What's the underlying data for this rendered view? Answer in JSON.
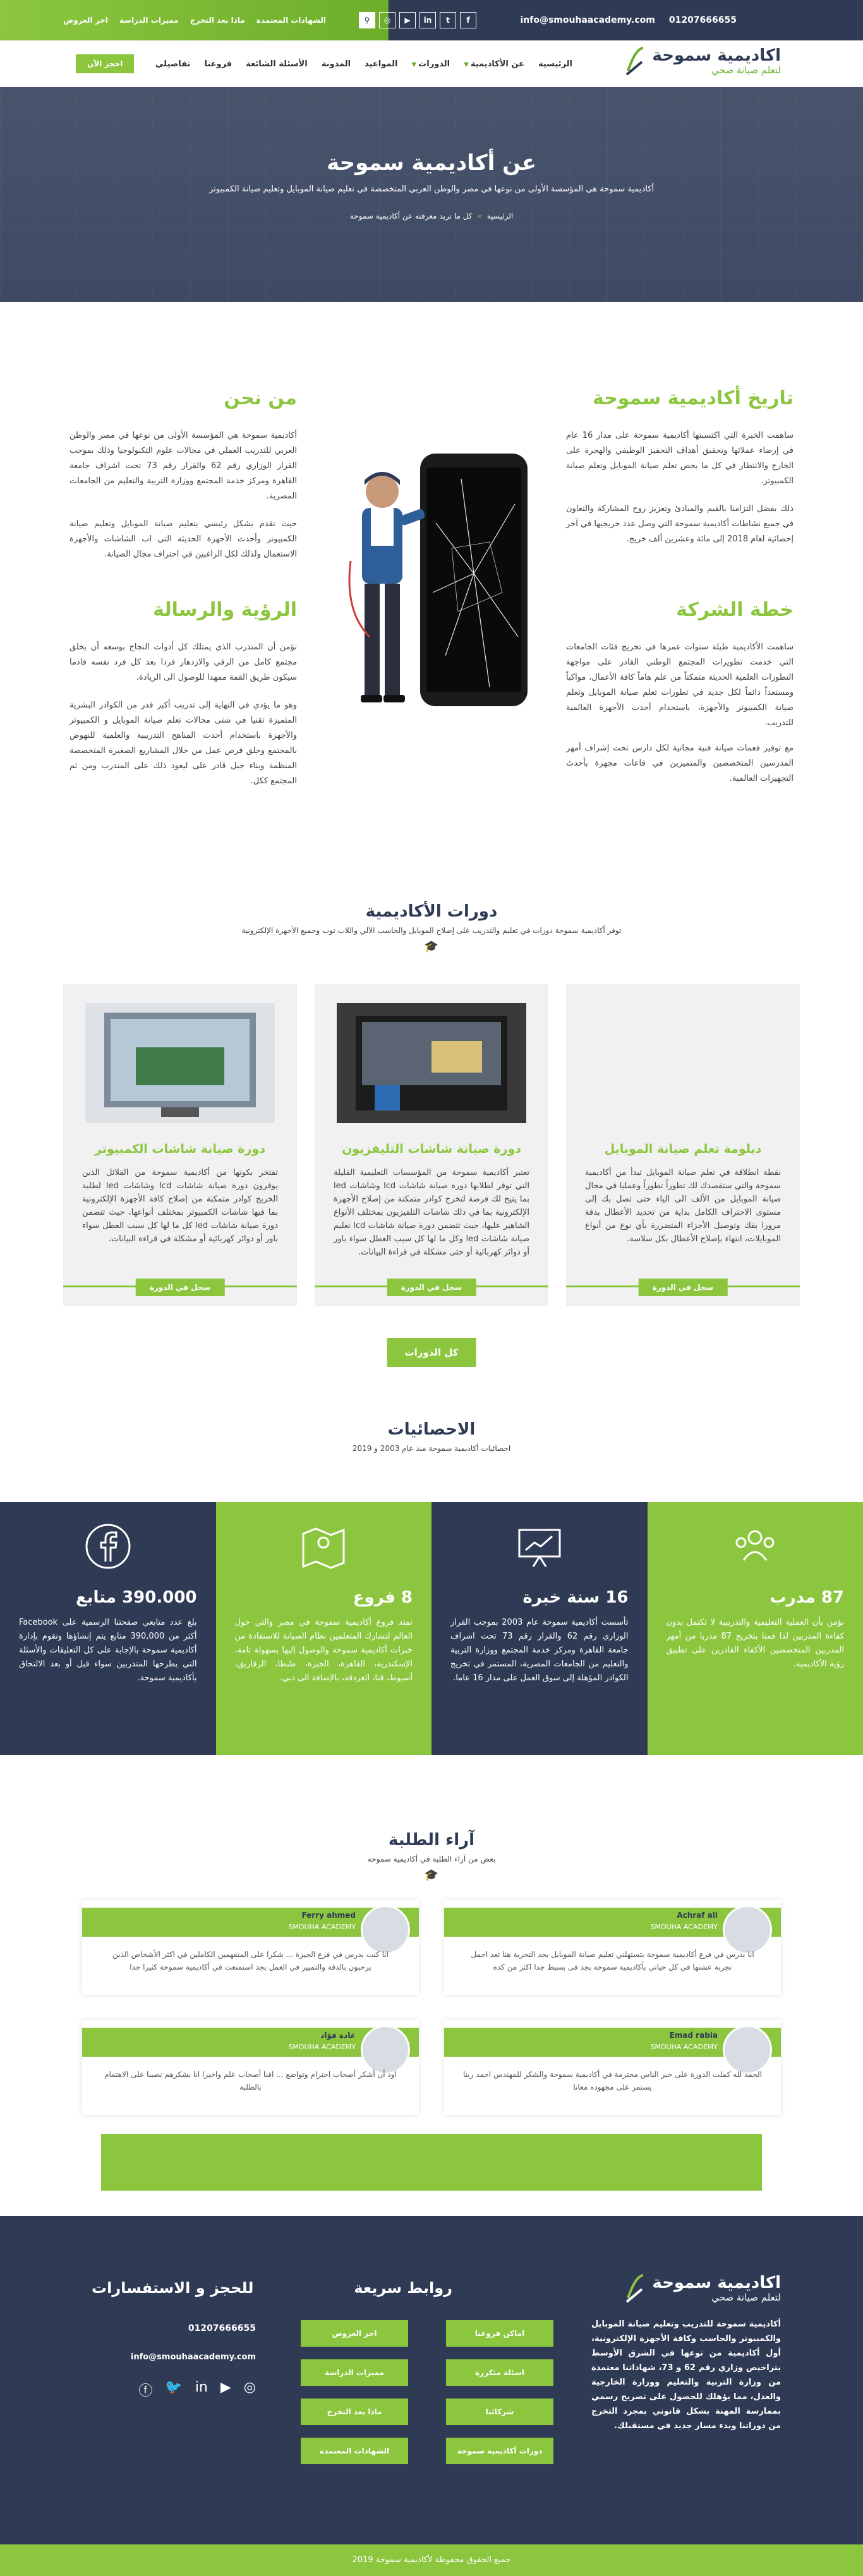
{
  "topbar": {
    "email": "info@smouhaacademy.com",
    "phone": "01207666655",
    "links": [
      "اخر العروض",
      "مميزات الدراسة",
      "ماذا بعد التخرج",
      "الشهادات المعتمدة"
    ],
    "socials": [
      "facebook-icon",
      "twitter-icon",
      "linkedin-icon",
      "youtube-icon",
      "instagram-icon",
      "search-icon"
    ]
  },
  "nav": {
    "logo_line1": "اكاديمية سموحة",
    "logo_line2": "لتعلم صيانة صحي",
    "menu": [
      "الرئيسية",
      "عن الأكاديمية",
      "الدورات",
      "المواعيد",
      "المدونة",
      "الأسئلة الشائعة",
      "فروعنا",
      "تفاصيلي"
    ],
    "book_label": "احجز الآن"
  },
  "hero": {
    "title": "عن أكاديمية سموحة",
    "subtitle": "أكاديمية سموحة هي المؤسسة الأولى من نوعها في مصر والوطن العربي المتخصصة في تعليم صيانة الموبايل وتعليم صيانة الكمبيوتر",
    "crumb_home": "الرئيسية",
    "crumb_current": "كل ما تريد معرفته عن أكاديمية سموحة"
  },
  "about": {
    "history_title": "تاريخ أكاديمية سموحة",
    "history_p1": "ساهمت الخبرة التي اكتسبتها أكاديمية سموحة على مدار 16 عام في إرضاء عملائها وتحقيق أهداف التحفيز الوظيفي والهجرة على الخارج والانتظار في كل ما يخص تعلم صيانة الموبايل وتعلم صيانة الكمبيوتر.",
    "history_p2": "ذلك بفضل التزامنا بالقيم والمبادئ وتعزيز روح المشاركة والتعاون في جميع نشاطات أكاديمية سموحة التي وصل عدد خريجيها في آخر إحصائية لعام 2018 إلى مائة وعشرين ألف خريج.",
    "plan_title": "خطة الشركة",
    "plan_p1": "ساهمت الأكاديمية طيلة سنوات عمرها في تخريج فئات الجامعات التي خدمت تطويرات المجتمع الوطني القادر على مواجهة التطورات العلمية الحديثة متمكناً من علم هاماً كافة الأعمال، مواكباً ومستعداً دائماً لكل جديد في تطورات تعلم صيانة الموبايل وتعلم صيانة الكمبيوتر والأجهزة، باستخدام أحدث الأجهزة العالمية للتدريب.",
    "plan_p2": "مع توفير فعمات صيانة فنية مجانية لكل دارس تحت إشراف أمهر المدرسين المتخصصين والمتميزين في قاعات مجهزة بأحدث التجهيزات العالمية.",
    "about_title": "من نحن",
    "about_p1": "أكاديمية سموحة هي المؤسسة الأولى من نوعها في مصر والوطن العربي للتدريب العملي في مجالات علوم التكنولوجيا وذلك بموجب القرار الوزاري رقم 62 والقرار رقم 73 تحت اشراف جامعة القاهرة ومركز خدمة المجتمع ووزارة التربية والتعليم من الجامعات المصرية.",
    "about_p2": "حيث تقدم بشكل رئيسي بتعليم صيانة الموبايل وتعليم صيانة الكمبيوتر وأحدث الأجهزة الحديثة التي اب الشاشات والأجهزة الاستعمال ولذلك لكل الراغبين في احتراف مجال الصيانة.",
    "vision_title": "الرؤية والرسالة",
    "vision_p1": "نؤمن أن المتدرب الذي يمتلك كل أدوات النجاح بوسعه أن يخلق مجتمع كامل من الرقي والازدهار فردا بعد كل فرد نفسه قادما سيكون طريق القمة ممهدا للوصول الى الريادة.",
    "vision_p2": "وهو ما يؤدي في النهاية إلى تدريب أكبر قدر من الكوادر البشرية المتميزة تقنيا في شتى مجالات تعلم صيانة الموبايل و الكمبيوتر والأجهزة باستخدام أحدث المناهج التدريبية والعلمية للنهوض بالمجتمع وخلق فرص عمل من خلال المشاريع الصغيرة المتخصصة المنظمة وبناء جيل قادر على ليعود ذلك على المتدرب ومن ثم المجتمع ككل."
  },
  "courses": {
    "title": "دورات الأكاديمية",
    "subtitle": "توفر أكاديمية سموحة دورات في تعليم والتدريب على إصلاح الموبايل والحاسب الآلي واللاب توب وجميع الأجهزة الإلكترونية",
    "items": [
      {
        "title": "دبلومة تعلم صيانة الموبايل",
        "desc": "نقطة انطلاقة في تعلم صيانة الموبايل تبدأ من أكاديمية سموحة والتي ستقصدك لك تطوراً تطوراً وعمليا في مجال صيانة الموبايل من الألف الى الياء حتى تصل بك إلى مستوى الاحتراف الكامل بداية من تحديد الأعطال بدقة مرورا بفك وتوصيل الأجزاء المتضررة بأي نوع من أنواع الموبايلات، انتهاء بإصلاح الأعطال بكل سلاسة.",
        "enroll": "سجل في الدورة"
      },
      {
        "title": "دورة صيانة شاشات التليفزيون",
        "desc": "تعتبر أكاديمية سموحة من المؤسسات التعليمية القليلة التي توفر لطلابها دورة صيانة شاشات lcd وشاشات led بما يتيح لك فرصة لتخرج كوادر متمكنة من إصلاح الأجهزة الإلكترونية بما في ذلك شاشات التلفيزيون بمختلف الأنواع الشاهير عليها، حيث تتضمن دورة صيانة شاشات lcd تعليم صيانة شاشات led وكل ما لها كل سبب العطل سواء باور أو دوائر كهربائية أو حتى مشكلة في قراءة البيانات.",
        "enroll": "سجل في الدورة"
      },
      {
        "title": "دورة صيانة شاشات الكمبيوتر",
        "desc": "تفتخر بكونها من أكاديمية سموحة من القلائل الذين يوفرون دورة صيانة شاشات lcd وشاشات led لطلبة الخريج كوادر متمكنة من إصلاح كافة الأجهزة الإلكترونية بما فيها شاشات الكمبيوتر بمختلف أنواعها، حيث تتضمن دورة صيانة شاشات led كل ما لها كل سبب العطل سواء باور أو دوائر كهربائية أو مشكلة في قراءة البيانات.",
        "enroll": "سجل في الدورة"
      }
    ],
    "all_label": "كل الدورات"
  },
  "stats": {
    "title": "الاحصائيات",
    "subtitle": "احصائيات أكاديمية سموحة منذ عام 2003 و 2019",
    "items": [
      {
        "icon": "group-icon",
        "value": "87 مدرب",
        "desc": "نؤمن بأن العملية التعليمية والتدريبية لا تكتمل بدون كفاءة المدربين لذا فمنا بتخريج 87 مدربا من أمهر المدربين المتخصصين الأكفاء القادرين على تطبيق رؤية الأكاديمية.",
        "style": "g"
      },
      {
        "icon": "presentation-icon",
        "value": "16 سنة خبرة",
        "desc": "تأسست أكاديمية سموحة عام 2003 بموجب القرار الوزاري رقم 62 والقرار رقم 73 تحت اشراف جامعة القاهرة ومركز خدمة المجتمع ووزارة التربية والتعليم من الجامعات المصرية، المستمر في تخريج الكوادر المؤهلة إلى سوق العمل على مدار 16 عاما.",
        "style": "d"
      },
      {
        "icon": "map-icon",
        "value": "8 فروع",
        "desc": "تمتد فروع أكاديمية سموحة في مصر والتي حول العالم لتشارك المتعلمين نظام الصيانة للاستفادة من خبرات أكاديمية سموحة والوصول إليها بسهولة تامة، الإسكندرية، القاهرة، الجيزة، طنطا، الزقازيق، أسيوط، قنا، الغردقة، بالإضافة الى دبي.",
        "style": "g"
      },
      {
        "icon": "facebook-icon",
        "value": "390.000 متابع",
        "desc": "بلغ عدد متابعي صفحتنا الرسمية على Facebook أكثر من 390,000 متابع يتم إنشاؤها ونقوم بإدارة أكاديمية سموحة بالإجابة على كل التعليقات والأسئلة التي يطرحها المتدربين سواء قبل أو بعد الالتحاق بأكاديمية سموحة.",
        "style": "d"
      }
    ]
  },
  "testimonials": {
    "title": "آراء الطلبة",
    "subtitle": "بعض من آراء الطلبة في أكاديمية سموحة",
    "items": [
      {
        "name": "Achraf ali",
        "role": "SMOUHA ACADEMY",
        "text": "انا بدرس في فرع أكاديمية سموحة بتستهلني تعليم صيانة الموبايل بجد التجربة هنا تعد اجمل تجربة عشتها في كل حياتي بأكاديمية سموحة بجد فى بسيط جدا اكثر من كده"
      },
      {
        "name": "Ferry ahmed",
        "role": "SMOUHA ACADEMY",
        "text": "انا كنت بدرس في فرع الجيزة ... شكرا على المتفهمين الكاملين في اكثر الأشخاص الذين يرحبون بالدقة والتمييز في العمل بجد استمتعت في أكاديمية سموحة كثيرا جدا"
      },
      {
        "name": "Emad rabia",
        "role": "SMOUHA ACADEMY",
        "text": "الحمد لله كملت الدورة على خير الناس محترمة في أكاديمية سموحة والشكر للمهندس احمد ربنا يستمر على مجهوده معانا"
      },
      {
        "name": "غادة فؤاد",
        "role": "SMOUHA ACADEMY",
        "text": "اود أن أشكر أصحاب احترام وتواضع ... اقنا أصحاب علم واخيرا انا بشكرهم نصيبا على الاهتمام بالطلبة"
      }
    ]
  },
  "footer": {
    "logo_line1": "اكاديمية سموحة",
    "logo_line2": "لتعلم صيانة صحي",
    "about": "أكاديمية سموحة للتدريب وتعليم صيانة الموبايل والكمبيوتر والحاسب وكافة الأجهزة الإلكترونية، أول أكاديمية من نوعها في الشرق الأوسط بتراخيص وزاري رقم 62 و 73، شهاداتنا معتمدة من وزارة التربية والتعليم ووزارة الخارجية والعدل، مما يؤهلك للحصول على تصريح رسمي بممارسة المهنة بشكل قانوني بمجرد التخرج من دوراتنا وبدء مسار جديد في مستقبلك.",
    "quick_title": "روابط سريعة",
    "quick_links": [
      "اماكن فروعنا",
      "اخر العروض",
      "اسئلة متكررة",
      "مميزات الدراسة",
      "شركائنا",
      "ماذا بعد التخرج",
      "دورات أكاديمية سموحة",
      "الشهادات المعتمدة"
    ],
    "contact_title": "للحجز و الاستفسارات",
    "phone": "01207666655",
    "email": "info@smouhaacademy.com",
    "copyright": "جميع الحقوق محفوظة لأكاديمية سموحة 2019"
  }
}
